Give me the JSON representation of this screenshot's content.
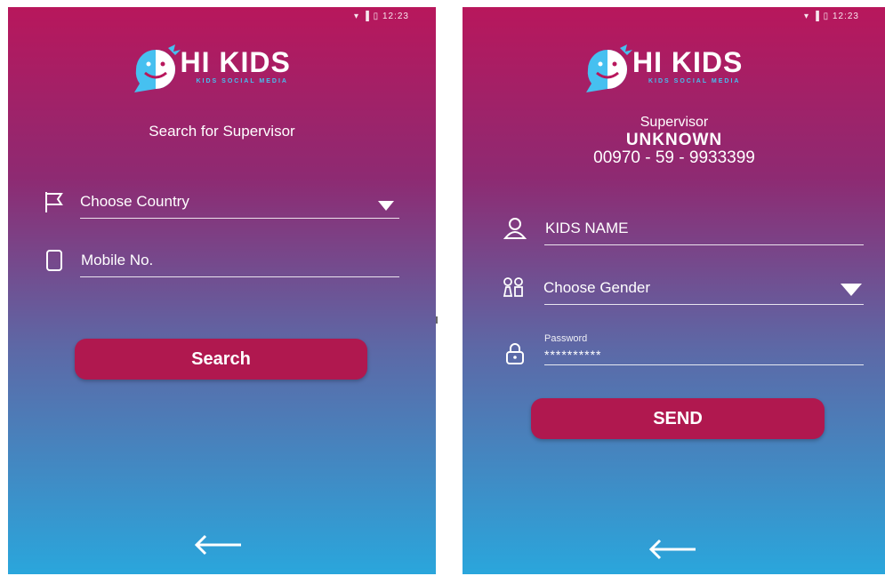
{
  "status_bar": {
    "time": "12:23",
    "wifi_icon": "wifi-icon",
    "signal_icon": "signal-icon",
    "battery_icon": "battery-icon"
  },
  "logo": {
    "name": "HI KIDS",
    "tagline": "KIDS SOCIAL MEDIA"
  },
  "screen1": {
    "title": "Search for Supervisor",
    "country_select": {
      "label": "Choose Country",
      "icon": "flag-icon"
    },
    "mobile_field": {
      "placeholder": "Mobile No.",
      "icon": "phone-icon"
    },
    "search_button": "Search",
    "back_icon": "arrow-left-icon"
  },
  "screen2": {
    "supervisor_label": "Supervisor",
    "supervisor_name": "UNKNOWN",
    "supervisor_phone": "00970 - 59 - 9933399",
    "kids_name_field": {
      "placeholder": "KIDS NAME",
      "icon": "user-icon"
    },
    "gender_select": {
      "label": "Choose Gender",
      "icon": "kids-icon"
    },
    "password_field": {
      "label": "Password",
      "value": "**********",
      "icon": "lock-icon"
    },
    "send_button": "SEND",
    "back_icon": "arrow-left-icon"
  },
  "colors": {
    "gradient_top": "#b8175c",
    "gradient_bottom": "#2aa6dc",
    "button": "#b0184f",
    "logo_accent": "#46c0f0"
  }
}
